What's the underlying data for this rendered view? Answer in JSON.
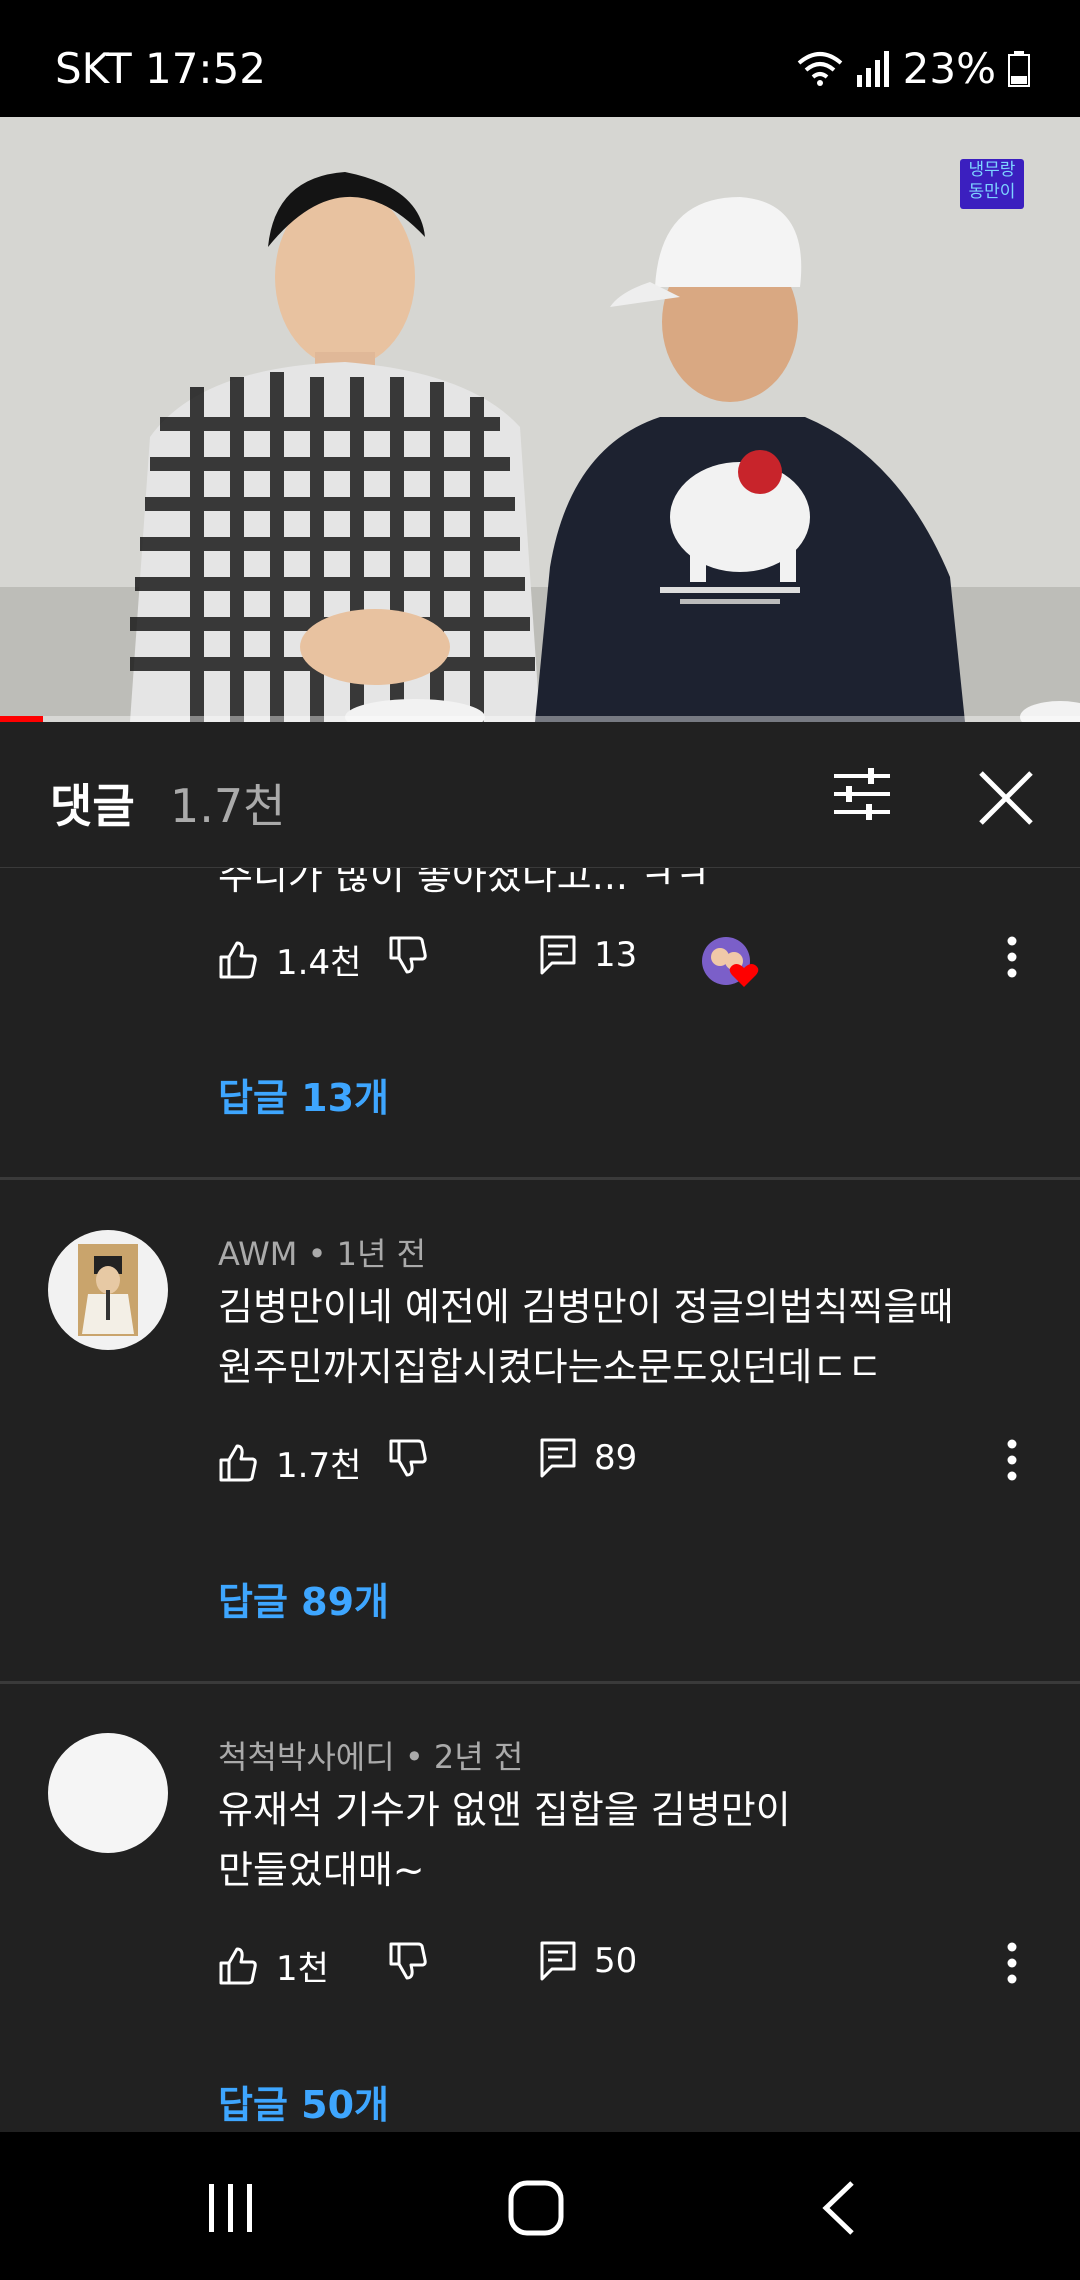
{
  "status_bar": {
    "carrier": "SKT",
    "time": "17:52",
    "battery": "23%"
  },
  "video": {
    "watermark": "냉무랑 동만이",
    "progress_percent": 4
  },
  "comments_header": {
    "title": "댓글",
    "count": "1.7천"
  },
  "comments": [
    {
      "id": "c0",
      "partial_text": "주니가 많이 좋아졌다고... ㅋㅋ",
      "likes": "1.4천",
      "reply_count": "13",
      "replies_label": "답글 13개",
      "creator_hearted": true
    },
    {
      "id": "c1",
      "author": "AWM",
      "time": "1년 전",
      "text_line1": "김병만이네 예전에 김병만이 정글의법칙찍을때",
      "text_line2": "원주민까지집합시켰다는소문도있던데ㄷㄷ",
      "likes": "1.7천",
      "reply_count": "89",
      "replies_label": "답글 89개"
    },
    {
      "id": "c2",
      "author": "척척박사에디",
      "time": "2년 전",
      "text_line1": "유재석 기수가 없앤 집합을 김병만이",
      "text_line2": "만들었대매~",
      "likes": "1천",
      "reply_count": "50",
      "replies_label": "답글 50개"
    }
  ],
  "colors": {
    "background": "#212121",
    "link": "#3ea6ff",
    "muted": "#aaaaaa",
    "progress": "#ff0000"
  },
  "icons": [
    "wifi-icon",
    "signal-icon",
    "battery-icon",
    "filter-icon",
    "close-icon",
    "thumb-up-icon",
    "thumb-down-icon",
    "comment-icon",
    "heart-icon",
    "more-vert-icon",
    "recent-apps-icon",
    "home-icon",
    "back-icon"
  ]
}
